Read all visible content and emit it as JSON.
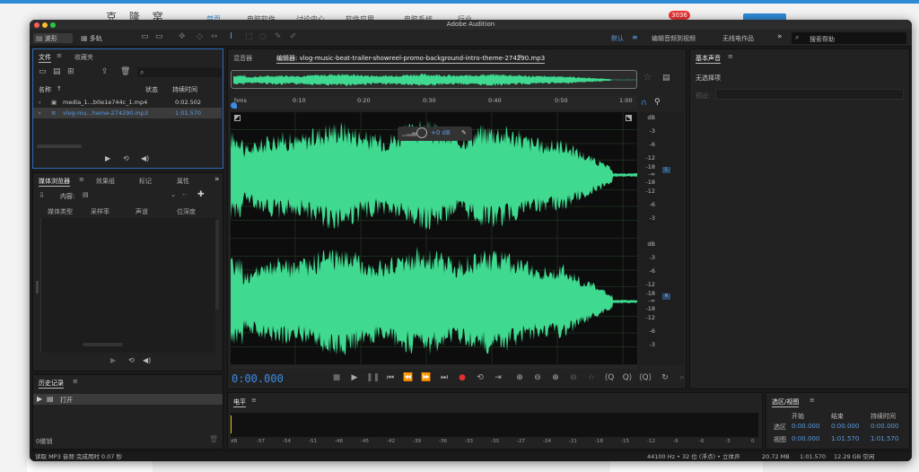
{
  "background_page": {
    "logo": "克 隆 窝",
    "nav": [
      "首页",
      "电脑软件",
      "讨论中心",
      "软件应用",
      "电脑系统",
      "行业"
    ],
    "badge": "3036"
  },
  "window": {
    "title": "Adobe Audition"
  },
  "toolbar": {
    "waveform_label": "波形",
    "multitrack_label": "多轨",
    "workspace_default": "默认",
    "workspace_edit_video": "编辑音频到视频",
    "workspace_radio": "无线电作品",
    "search_placeholder": "搜索帮助"
  },
  "files_panel": {
    "tab_files": "文件",
    "tab_favorites": "收藏夹",
    "col_name": "名称",
    "col_status": "状态",
    "col_duration": "持续时间",
    "files": [
      {
        "name": "media_1...b0e1e744c_1.mp4",
        "duration": "0:02.502"
      },
      {
        "name": "vlog-mu...heme-274290.mp3",
        "duration": "1:01.570"
      }
    ]
  },
  "media_browser": {
    "tab_media": "媒体浏览器",
    "tab_effects": "效果组",
    "tab_markers": "标记",
    "tab_properties": "属性",
    "content_label": "内容:",
    "cols": [
      "媒体类型",
      "采样率",
      "声道",
      "位深度"
    ]
  },
  "history": {
    "title": "历史记录",
    "item": "打开",
    "undo_count": "0撤销"
  },
  "editor": {
    "tab_mixer": "混音器",
    "tab_editor": "编辑器: vlog-music-beat-trailer-showreel-promo-background-intro-theme-274290.mp3",
    "ruler": [
      "hms",
      "0:10",
      "0:20",
      "0:30",
      "0:40",
      "0:50",
      "1:00"
    ],
    "db_scale": [
      "dB",
      "-3",
      "-6",
      "-12",
      "-18",
      "-∞",
      "-18",
      "-12",
      "-6",
      "-3"
    ],
    "hud_value": "+0 dB",
    "time_display": "0:00.000",
    "channel_top": "L",
    "channel_bottom": "R",
    "waveform_color": "#3fd98f"
  },
  "essential_sound": {
    "title": "基本声音",
    "no_selection": "无选择项",
    "preset_label": "预设:"
  },
  "levels": {
    "title": "电平",
    "scale": [
      "dB",
      "-57",
      "-54",
      "-51",
      "-48",
      "-45",
      "-42",
      "-39",
      "-36",
      "-33",
      "-30",
      "-27",
      "-24",
      "-21",
      "-18",
      "-15",
      "-12",
      "-9",
      "-6",
      "-3",
      "0"
    ]
  },
  "selection_view": {
    "title": "选区/视图",
    "col_start": "开始",
    "col_end": "结束",
    "col_duration": "持续时间",
    "sel_label": "选区",
    "view_label": "视图",
    "sel_start": "0:00.000",
    "sel_end": "0:00.000",
    "sel_duration": "0:00.000",
    "view_start": "0:00.000",
    "view_end": "1:01.570",
    "view_duration": "1:01.570"
  },
  "status_bar": {
    "message": "读取 MP3 音频 完成用时 0.07 秒",
    "format": "44100 Hz • 32 位 (浮点) • 立体声",
    "size": "20.72 MB",
    "duration": "1:01.570",
    "disk": "12.29 GB 空闲"
  }
}
